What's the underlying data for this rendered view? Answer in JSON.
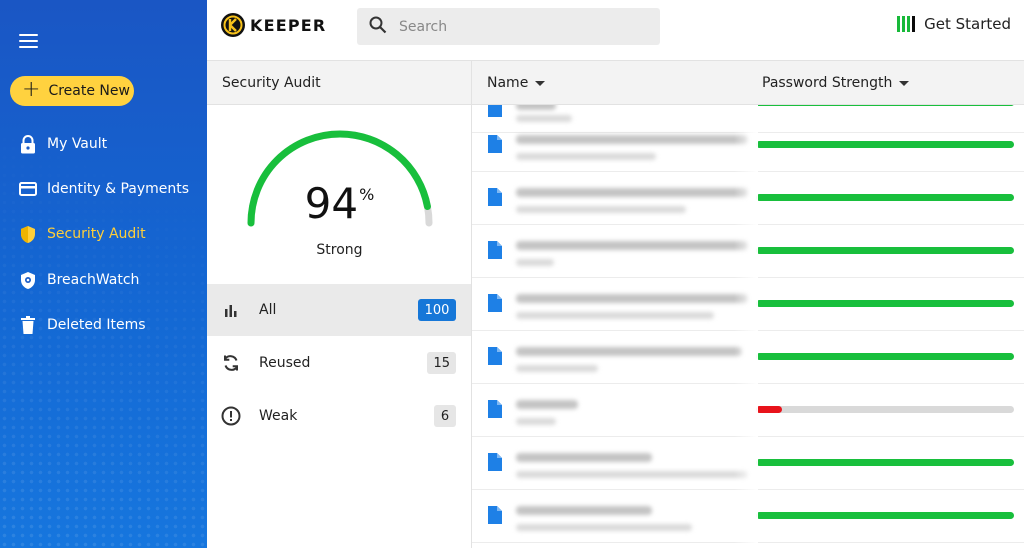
{
  "sidebar": {
    "create_label": "Create New",
    "items": [
      {
        "label": "My Vault",
        "icon": "lock-icon"
      },
      {
        "label": "Identity & Payments",
        "icon": "card-icon"
      },
      {
        "label": "Security Audit",
        "icon": "shield-icon",
        "active": true
      },
      {
        "label": "BreachWatch",
        "icon": "breachwatch-icon"
      },
      {
        "label": "Deleted Items",
        "icon": "trash-icon"
      }
    ],
    "active_color": "#ffcf3a"
  },
  "topbar": {
    "logo_text": "KEEPER",
    "search_placeholder": "Search",
    "get_started_label": "Get Started"
  },
  "audit": {
    "header": "Security Audit",
    "score": "94",
    "score_unit": "%",
    "score_fraction": 0.94,
    "strength": "Strong",
    "filters": [
      {
        "label": "All",
        "count": "100",
        "selected": true
      },
      {
        "label": "Reused",
        "count": "15"
      },
      {
        "label": "Weak",
        "count": "6"
      }
    ]
  },
  "table": {
    "col_name": "Name",
    "col_strength": "Password Strength",
    "rows": [
      {
        "strength": 1.0,
        "color": "#18bf3c"
      },
      {
        "strength": 1.0,
        "color": "#18bf3c"
      },
      {
        "strength": 1.0,
        "color": "#18bf3c"
      },
      {
        "strength": 1.0,
        "color": "#18bf3c"
      },
      {
        "strength": 1.0,
        "color": "#18bf3c"
      },
      {
        "strength": 1.0,
        "color": "#18bf3c"
      },
      {
        "strength": 0.1,
        "color": "#e8131b"
      },
      {
        "strength": 1.0,
        "color": "#18bf3c"
      },
      {
        "strength": 1.0,
        "color": "#18bf3c"
      }
    ]
  },
  "colors": {
    "gauge_fill": "#18bf3c",
    "gauge_track": "#d9d9d9",
    "accent_blue": "#1677d8",
    "create_button": "#ffd23f"
  }
}
